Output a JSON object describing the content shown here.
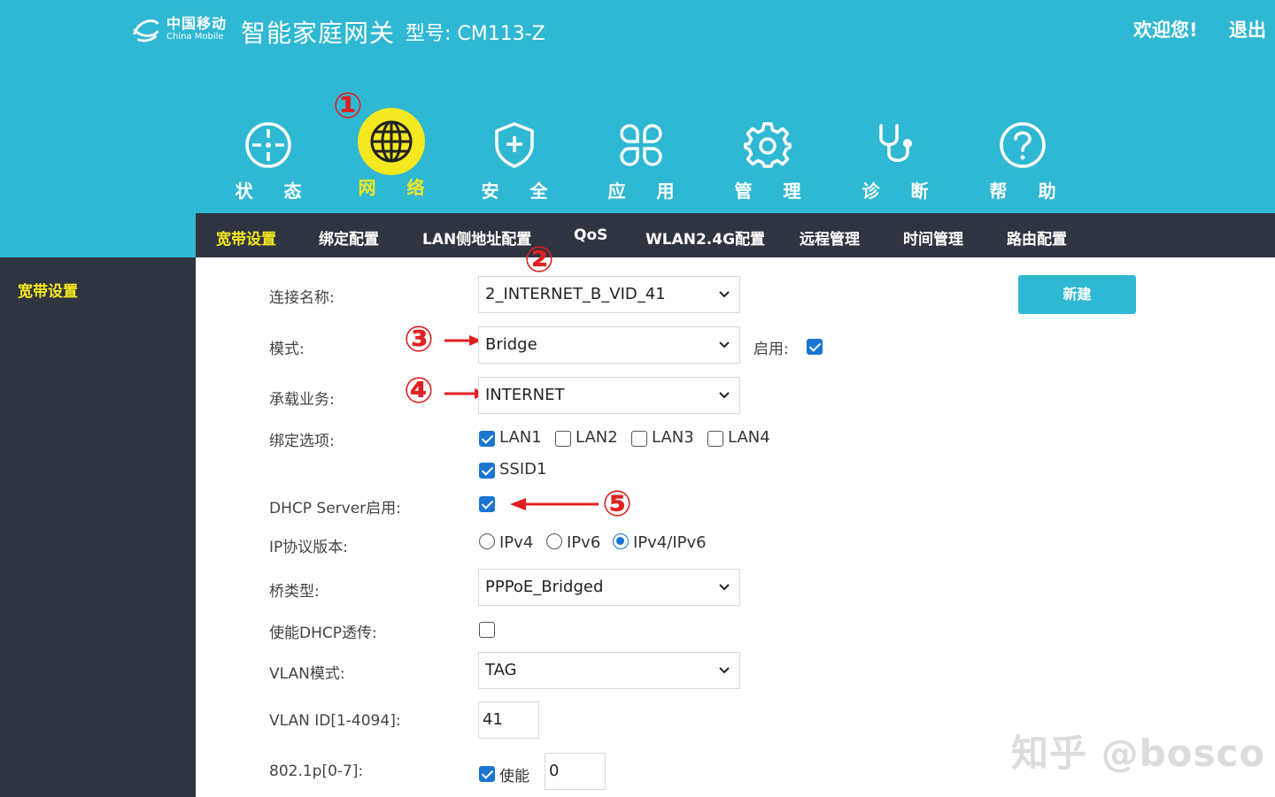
{
  "header": {
    "logo_cn": "中国移动",
    "logo_en": "China Mobile",
    "product": "智能家庭网关",
    "model": "型号: CM113-Z",
    "welcome": "欢迎您!",
    "logout": "退出"
  },
  "nav": [
    {
      "label": "状 态",
      "icon": "target-icon",
      "active": false
    },
    {
      "label": "网 络",
      "icon": "globe-icon",
      "active": true
    },
    {
      "label": "安 全",
      "icon": "shield-icon",
      "active": false
    },
    {
      "label": "应 用",
      "icon": "apps-icon",
      "active": false
    },
    {
      "label": "管 理",
      "icon": "gear-icon",
      "active": false
    },
    {
      "label": "诊 断",
      "icon": "stethoscope-icon",
      "active": false
    },
    {
      "label": "帮 助",
      "icon": "help-icon",
      "active": false
    }
  ],
  "subtabs": [
    "宽带设置",
    "绑定配置",
    "LAN侧地址配置",
    "QoS",
    "WLAN2.4G配置",
    "远程管理",
    "时间管理",
    "路由配置"
  ],
  "sidebar": {
    "item": "宽带设置"
  },
  "annotations": [
    "①",
    "②",
    "③",
    "④",
    "⑤"
  ],
  "form": {
    "connection_name": {
      "label": "连接名称:",
      "value": "2_INTERNET_B_VID_41"
    },
    "mode": {
      "label": "模式:",
      "value": "Bridge",
      "enable_label": "启用:",
      "enabled": true
    },
    "service": {
      "label": "承载业务:",
      "value": "INTERNET"
    },
    "binding": {
      "label": "绑定选项:",
      "options": [
        {
          "name": "LAN1",
          "checked": true
        },
        {
          "name": "LAN2",
          "checked": false
        },
        {
          "name": "LAN3",
          "checked": false
        },
        {
          "name": "LAN4",
          "checked": false
        },
        {
          "name": "SSID1",
          "checked": true
        }
      ]
    },
    "dhcp_server": {
      "label": "DHCP Server启用:",
      "checked": true
    },
    "ip_version": {
      "label": "IP协议版本:",
      "options": [
        "IPv4",
        "IPv6",
        "IPv4/IPv6"
      ],
      "selected": "IPv4/IPv6"
    },
    "bridge_type": {
      "label": "桥类型:",
      "value": "PPPoE_Bridged"
    },
    "dhcp_passthrough": {
      "label": "使能DHCP透传:",
      "checked": false
    },
    "vlan_mode": {
      "label": "VLAN模式:",
      "value": "TAG"
    },
    "vlan_id": {
      "label": "VLAN ID[1-4094]:",
      "value": "41"
    },
    "priority": {
      "label": "802.1p[0-7]:",
      "enable_label": "使能",
      "enabled": true,
      "value": "0"
    }
  },
  "new_button": "新建",
  "watermark": "知乎 @bosco",
  "colors": {
    "header": "#2fb8d3",
    "dark": "#2f3540",
    "accent": "#f4e820",
    "checkbox": "#1976d2",
    "annotation": "#e02020"
  }
}
